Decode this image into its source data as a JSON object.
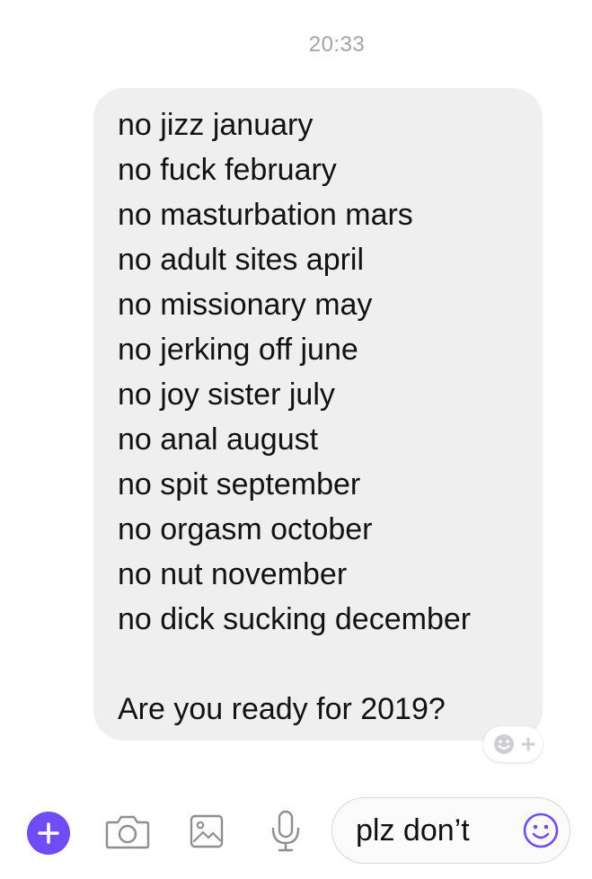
{
  "header": {
    "timestamp": "20:33"
  },
  "message": {
    "lines": [
      "no jizz january",
      "no fuck february",
      "no masturbation mars",
      "no adult sites april",
      "no missionary may",
      "no jerking off june",
      "no joy sister july",
      "no anal august",
      "no spit september",
      "no orgasm october",
      "no nut november",
      "no dick sucking december",
      "",
      "Are you ready for 2019?"
    ]
  },
  "reaction": {
    "icon": "add-reaction-icon"
  },
  "composer": {
    "input_value": "plz don’t",
    "icons": [
      "plus-icon",
      "camera-icon",
      "image-icon",
      "microphone-icon",
      "emoji-icon"
    ],
    "accent_color": "#6f4cf5"
  }
}
